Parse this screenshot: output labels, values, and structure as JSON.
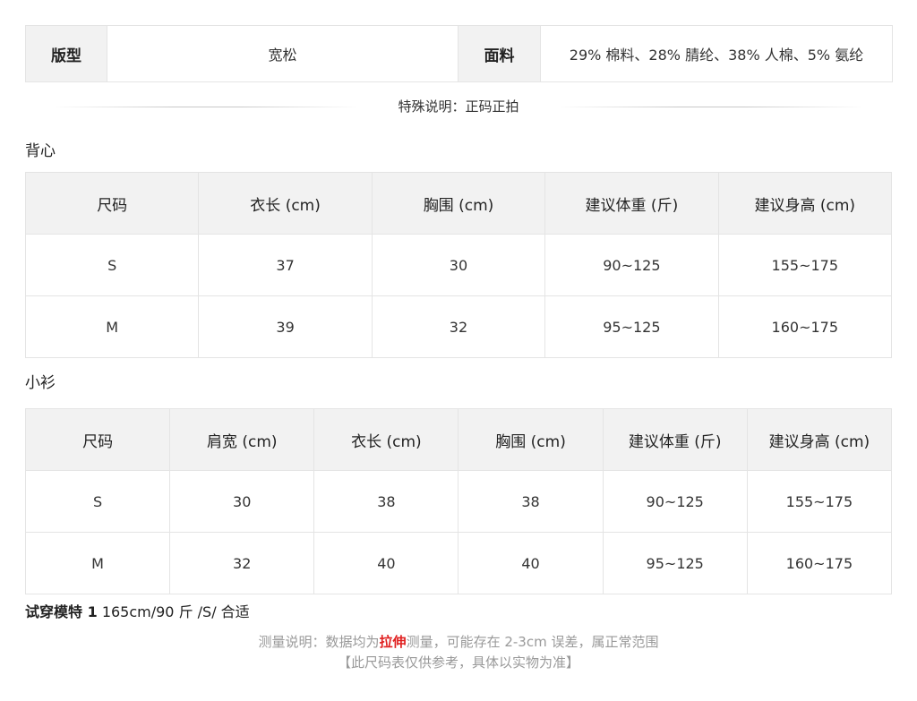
{
  "fabric_table": {
    "type_label": "版型",
    "type_value": "宽松",
    "fabric_label": "面料",
    "fabric_value": "29% 棉料、28% 腈纶、38% 人棉、5% 氨纶"
  },
  "special_note": "特殊说明：正码正拍",
  "vest": {
    "title": "背心",
    "headers": [
      "尺码",
      "衣长 (cm)",
      "胸围 (cm)",
      "建议体重 (斤)",
      "建议身高 (cm)"
    ],
    "rows": [
      [
        "S",
        "37",
        "30",
        "90~125",
        "155~175"
      ],
      [
        "M",
        "39",
        "32",
        "95~125",
        "160~175"
      ]
    ]
  },
  "shirt": {
    "title": "小衫",
    "headers": [
      "尺码",
      "肩宽 (cm)",
      "衣长 (cm)",
      "胸围 (cm)",
      "建议体重 (斤)",
      "建议身高 (cm)"
    ],
    "rows": [
      [
        "S",
        "30",
        "38",
        "38",
        "90~125",
        "155~175"
      ],
      [
        "M",
        "32",
        "40",
        "40",
        "95~125",
        "160~175"
      ]
    ]
  },
  "model": {
    "label": "试穿模特 1",
    "value": "165cm/90 斤 /S/ 合适"
  },
  "notes": {
    "line1_prefix": "测量说明：数据均为",
    "line1_highlight": "拉伸",
    "line1_suffix": "测量，可能存在 2-3cm 误差，属正常范围",
    "line2": "【此尺码表仅供参考，具体以实物为准】"
  },
  "colors": {
    "header_bg": "#f2f2f2",
    "border": "#e4e4e4",
    "highlight": "#e02020",
    "note_gray": "#999999"
  }
}
